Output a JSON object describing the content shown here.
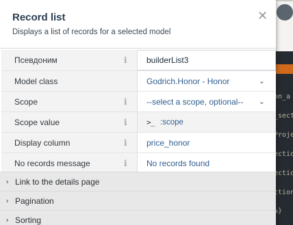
{
  "background": {
    "code_lines": [
      "on_a",
      "_sect",
      "Proje",
      "ectio",
      "ection",
      "ction",
      "ction",
      "%}"
    ]
  },
  "popover": {
    "title": "Record list",
    "description": "Displays a list of records for a selected model",
    "close_icon": "close-icon"
  },
  "properties": [
    {
      "label": "Псевдоним",
      "value": "builderList3",
      "kind": "text-input",
      "info": true
    },
    {
      "label": "Model class",
      "value": "Godrich.Honor - Honor",
      "kind": "dropdown",
      "info": false
    },
    {
      "label": "Scope",
      "value": "--select a scope, optional--",
      "kind": "dropdown",
      "info": true
    },
    {
      "label": "Scope value",
      "value": ":scope",
      "prompt": ">_",
      "kind": "scope",
      "info": true
    },
    {
      "label": "Display column",
      "value": "price_honor",
      "kind": "text",
      "info": true
    },
    {
      "label": "No records message",
      "value": "No records found",
      "kind": "text",
      "info": true
    }
  ],
  "groups": [
    {
      "label": "Link to the details page"
    },
    {
      "label": "Pagination"
    },
    {
      "label": "Sorting"
    }
  ],
  "colors": {
    "accent_orange": "#cf6a1d",
    "value_blue": "#2e5e90",
    "title_navy": "#2a3e51"
  }
}
